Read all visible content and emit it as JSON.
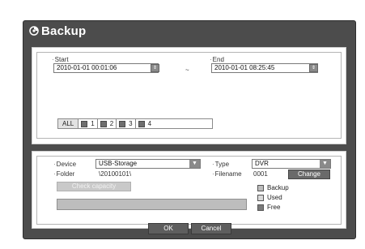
{
  "dialog": {
    "title": "Backup"
  },
  "period": {
    "start_label": "Start",
    "start_value": "2010-01-01 00:01:06",
    "separator": "~",
    "end_label": "End",
    "end_value": "2010-01-01 08:25:45",
    "spin_glyph": "⇕"
  },
  "channels": {
    "all_label": "ALL",
    "items": [
      {
        "label": "1",
        "checked": false
      },
      {
        "label": "2",
        "checked": false
      },
      {
        "label": "3",
        "checked": false
      },
      {
        "label": "4",
        "checked": false
      }
    ]
  },
  "device": {
    "label": "Device",
    "value": "USB-Storage"
  },
  "type": {
    "label": "Type",
    "value": "DVR"
  },
  "folder": {
    "label": "Folder",
    "value": "\\20100101\\"
  },
  "filename": {
    "label": "Filename",
    "value": "0001",
    "change_label": "Change"
  },
  "capacity": {
    "check_label": "Check capacity",
    "fill_fraction": 0
  },
  "legend": [
    {
      "label": "Backup",
      "color": "#bdbdbd"
    },
    {
      "label": "Used",
      "color": "#d9d9d9"
    },
    {
      "label": "Free",
      "color": "#7a7a7a"
    }
  ],
  "footer": {
    "ok_label": "OK",
    "cancel_label": "Cancel"
  },
  "colors": {
    "window_bg": "#4c4c4c",
    "button_bg": "#6a6a6a",
    "disabled_button": "#c9c9c9"
  },
  "icons": {
    "title": "backup-cd-icon",
    "dropdown": "chevron-down-icon",
    "spin": "spin-arrows-icon"
  }
}
